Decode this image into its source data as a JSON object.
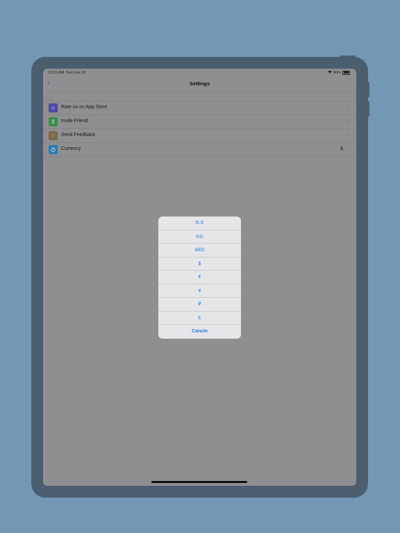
{
  "status": {
    "time": "12:31 AM",
    "date": "Sun Jun 18",
    "battery": "96%"
  },
  "nav": {
    "back": "‹",
    "title": "Settings"
  },
  "rows": [
    {
      "label": "Rate us on App Store",
      "icon": "star-icon",
      "icon_glyph": "☆",
      "color": "#4b4ba8",
      "value": ""
    },
    {
      "label": "Invite Friend",
      "icon": "share-icon",
      "icon_glyph": "⇪",
      "color": "#3f8a4f",
      "value": ""
    },
    {
      "label": "Send Feedback",
      "icon": "feedback-icon",
      "icon_glyph": "◌",
      "color": "#7a6a45",
      "value": ""
    },
    {
      "label": "Currency",
      "icon": "currency-icon",
      "icon_glyph": "◷",
      "color": "#2a7db3",
      "value": "$"
    }
  ],
  "chevron": "›",
  "currency_sheet": {
    "options": [
      "R.S",
      "KD",
      "AED",
      "$",
      "€",
      "¥",
      "₽",
      "£"
    ],
    "cancel": "Cancle"
  },
  "colors": {
    "background": "#7397b5",
    "device": "#4b5e70",
    "accent": "#2b7be0"
  }
}
